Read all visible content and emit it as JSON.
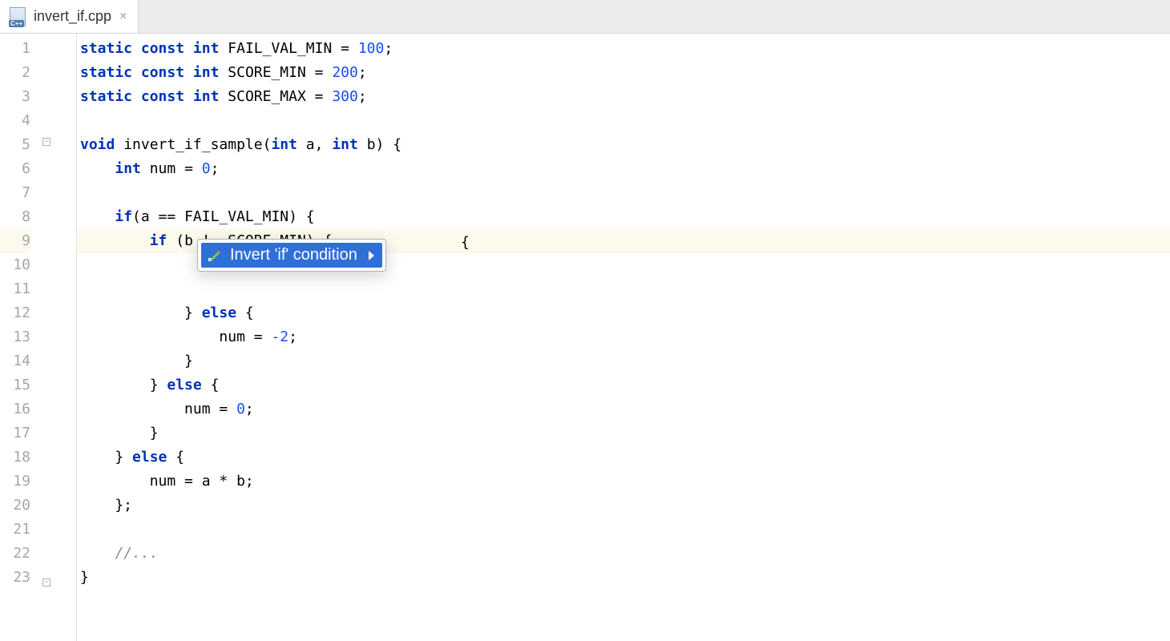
{
  "tab": {
    "filename": "invert_if.cpp",
    "close_glyph": "×"
  },
  "gutter": {
    "lines": [
      "1",
      "2",
      "3",
      "4",
      "5",
      "6",
      "7",
      "8",
      "9",
      "10",
      "11",
      "12",
      "13",
      "14",
      "15",
      "16",
      "17",
      "18",
      "19",
      "20",
      "21",
      "22",
      "23"
    ]
  },
  "active_line_index": 8,
  "code": {
    "l1": {
      "kw1": "static",
      "kw2": "const",
      "kw3": "int",
      "ident": "FAIL_VAL_MIN",
      "eq": "=",
      "val": "100",
      "semi": ";"
    },
    "l2": {
      "kw1": "static",
      "kw2": "const",
      "kw3": "int",
      "ident": "SCORE_MIN",
      "eq": "=",
      "val": "200",
      "semi": ";"
    },
    "l3": {
      "kw1": "static",
      "kw2": "const",
      "kw3": "int",
      "ident": "SCORE_MAX",
      "eq": "=",
      "val": "300",
      "semi": ";"
    },
    "l4": "",
    "l5": {
      "kw1": "void",
      "fn": "invert_if_sample(",
      "kw2": "int",
      "p1": "a,",
      "kw3": "int",
      "p2": "b) {"
    },
    "l6": {
      "indent": "    ",
      "kw1": "int",
      "rest": "num =",
      "val": "0",
      "semi": ";"
    },
    "l7": "",
    "l8": {
      "indent": "    ",
      "kw1": "if",
      "rest": "(a == FAIL_VAL_MIN) {"
    },
    "l9": {
      "indent": "        ",
      "kw1": "if",
      "rest": "(b != SCORE_MIN) {"
    },
    "l10_peek": "{",
    "l12": {
      "indent": "            } ",
      "kw1": "else",
      "rest": " {"
    },
    "l13": {
      "indent": "                num = ",
      "val": "-2",
      "semi": ";"
    },
    "l14": "            }",
    "l15": {
      "indent": "        } ",
      "kw1": "else",
      "rest": " {"
    },
    "l16": {
      "indent": "            num = ",
      "val": "0",
      "semi": ";"
    },
    "l17": "        }",
    "l18": {
      "indent": "    } ",
      "kw1": "else",
      "rest": " {"
    },
    "l19": "        num = a * b;",
    "l20": "    };",
    "l21": "",
    "l22": {
      "indent": "    ",
      "comment": "//..."
    },
    "l23": "}"
  },
  "popup": {
    "item_label": "Invert 'if' condition"
  }
}
